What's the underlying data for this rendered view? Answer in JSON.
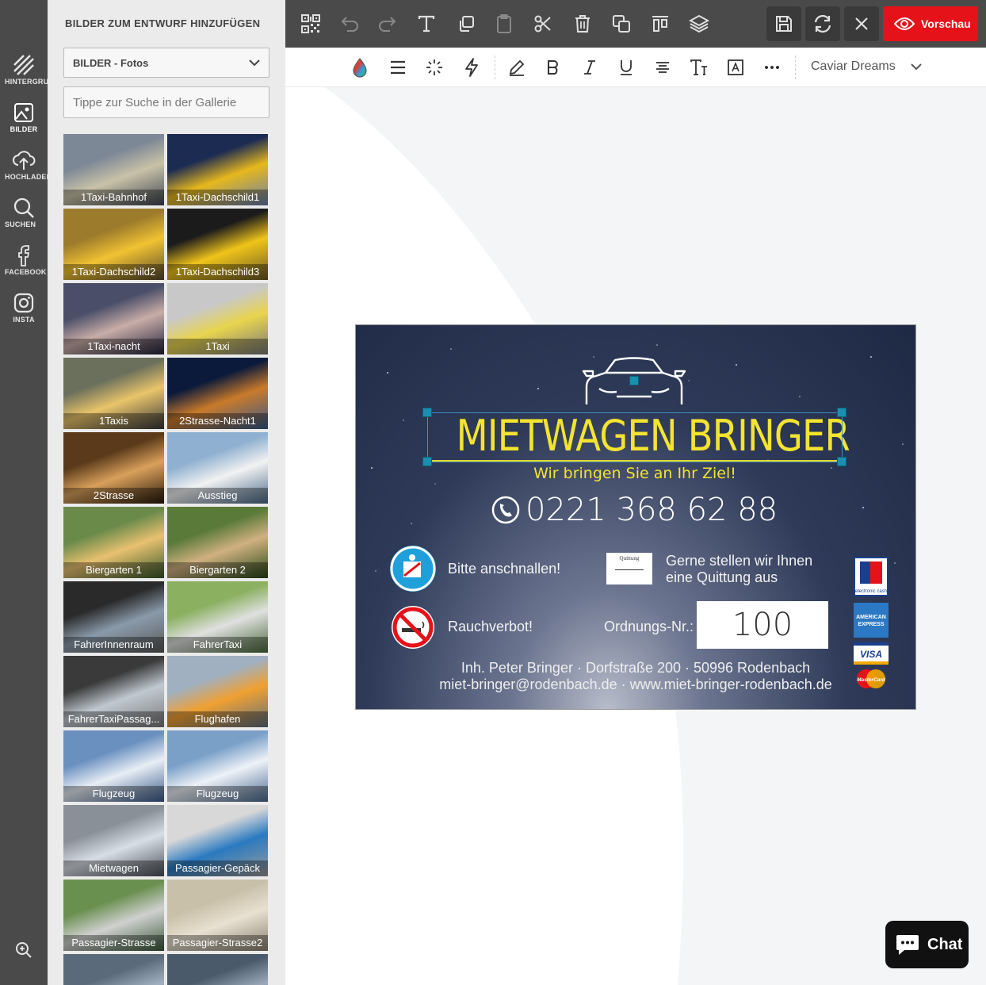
{
  "rail": {
    "items": [
      {
        "label": "HINTERGRUND",
        "icon": "background-stripes-icon"
      },
      {
        "label": "BILDER",
        "icon": "image-icon"
      },
      {
        "label": "HOCHLADEN",
        "icon": "cloud-upload-icon"
      },
      {
        "label": "SUCHEN",
        "icon": "search-icon"
      },
      {
        "label": "FACEBOOK",
        "icon": "facebook-icon"
      },
      {
        "label": "INSTA",
        "icon": "instagram-icon"
      }
    ],
    "active": "BILDER"
  },
  "panel": {
    "title": "BILDER ZUM ENTWURF HINZUFÜGEN",
    "category_select": "BILDER - Fotos",
    "search_placeholder": "Tippe zur Suche in der Gallerie",
    "images": [
      "1Taxi-Bahnhof",
      "1Taxi-Dachschild1",
      "1Taxi-Dachschild2",
      "1Taxi-Dachschild3",
      "1Taxi-nacht",
      "1Taxi",
      "1Taxis",
      "2Strasse-Nacht1",
      "2Strasse",
      "Ausstieg",
      "Biergarten 1",
      "Biergarten 2",
      "FahrerInnenraum",
      "FahrerTaxi",
      "FahrerTaxiPassag...",
      "Flughafen",
      "Flugzeug",
      "Flugzeug",
      "Mietwagen",
      "Passagier-Gepäck",
      "Passagier-Strasse",
      "Passagier-Strasse2",
      "",
      ""
    ]
  },
  "toolbar": {
    "preview_label": "Vorschau"
  },
  "format": {
    "font_name": "Caviar Dreams"
  },
  "card": {
    "brand": "MIETWAGEN BRINGER",
    "tagline": "Wir bringen Sie an Ihr Ziel!",
    "phone": "0221 368 62 88",
    "seatbelt": "Bitte anschnallen!",
    "receipt_icon_text": "Quittung",
    "receipt_text_1": "Gerne stellen wir Ihnen",
    "receipt_text_2": "eine Quittung aus",
    "no_smoking": "Rauchverbot!",
    "order_label": "Ordnungs-Nr.:",
    "order_number": "100",
    "footer_1": "Inh. Peter Bringer · Dorfstraße 200 · 50996 Rodenbach",
    "footer_2": "miet-bringer@rodenbach.de · www.miet-bringer-rodenbach.de",
    "cards": {
      "ec": "electronic cash",
      "amex": "AMERICAN EXPRESS",
      "visa": "VISA",
      "mastercard": "MasterCard"
    }
  },
  "chat": {
    "label": "Chat"
  },
  "colors": {
    "accent_red": "#e6121a",
    "brand_yellow": "#f4e430",
    "toolbar_dark": "#4a4a4a",
    "handle_teal": "#1a8fb0"
  }
}
